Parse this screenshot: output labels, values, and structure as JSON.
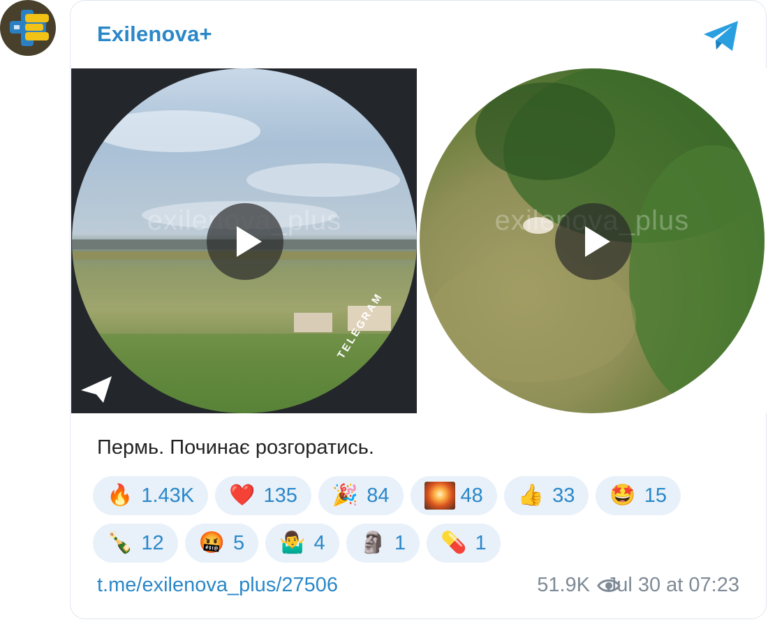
{
  "channel": {
    "name": "Exilenova+"
  },
  "media": [
    {
      "watermark": "exilenova_plus",
      "badge": "TELEGRAM"
    },
    {
      "watermark": "exilenova_plus"
    }
  ],
  "post": {
    "caption": "Пермь. Починає розгоратись."
  },
  "reactions": [
    {
      "emoji": "🔥",
      "count": "1.43K"
    },
    {
      "emoji": "❤️",
      "count": "135"
    },
    {
      "emoji": "🎉",
      "count": "84"
    },
    {
      "emoji": "explosion",
      "count": "48"
    },
    {
      "emoji": "👍",
      "count": "33"
    },
    {
      "emoji": "🤩",
      "count": "15"
    },
    {
      "emoji": "🍾",
      "count": "12"
    },
    {
      "emoji": "🤬",
      "count": "5"
    },
    {
      "emoji": "🤷‍♂️",
      "count": "4"
    },
    {
      "emoji": "🗿",
      "count": "1"
    },
    {
      "emoji": "💊",
      "count": "1"
    }
  ],
  "footer": {
    "link": "t.me/exilenova_plus/27506",
    "views": "51.9K",
    "date": "Jul 30 at 07:23"
  },
  "colors": {
    "accent": "#2a87c8",
    "muted": "#7e8a96",
    "pill": "#e8f1fa"
  }
}
